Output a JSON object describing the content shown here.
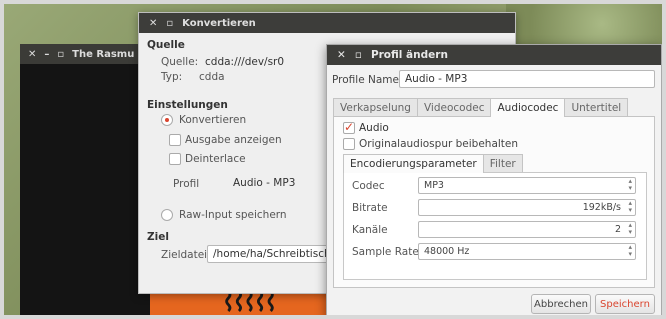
{
  "rasmus_window": {
    "title": "The Rasmu"
  },
  "konvertieren": {
    "title": "Konvertieren",
    "quelle_heading": "Quelle",
    "quelle_label": "Quelle:",
    "quelle_value": "cdda:///dev/sr0",
    "typ_label": "Typ:",
    "typ_value": "cdda",
    "einstellungen_heading": "Einstellungen",
    "konvertieren_option": "Konvertieren",
    "ausgabe_anzeigen": "Ausgabe anzeigen",
    "deinterlace": "Deinterlace",
    "profil_label": "Profil",
    "profil_value": "Audio - MP3",
    "raw_input": "Raw-Input speichern",
    "ziel_heading": "Ziel",
    "zieldatei_label": "Zieldatei:",
    "zieldatei_value": "/home/ha/Schreibtisch/s"
  },
  "profil": {
    "title": "Profil ändern",
    "profile_name_label": "Profile Name",
    "profile_name_value": "Audio - MP3",
    "tabs": [
      "Verkapselung",
      "Videocodec",
      "Audiocodec",
      "Untertitel"
    ],
    "audio_checkbox": "Audio",
    "original_checkbox": "Originalaudiospur beibehalten",
    "subtabs": [
      "Encodierungsparameter",
      "Filter"
    ],
    "codec_label": "Codec",
    "codec_value": "MP3",
    "bitrate_label": "Bitrate",
    "bitrate_value": "192kB/s",
    "kanaele_label": "Kanäle",
    "kanaele_value": "2",
    "sample_rate_label": "Sample Rate",
    "sample_rate_value": "48000 Hz",
    "cancel_label": "Abbrechen",
    "save_label": "Speichern"
  },
  "colors": {
    "accent": "#d9452f",
    "titlebar": "#3d3d3a"
  }
}
